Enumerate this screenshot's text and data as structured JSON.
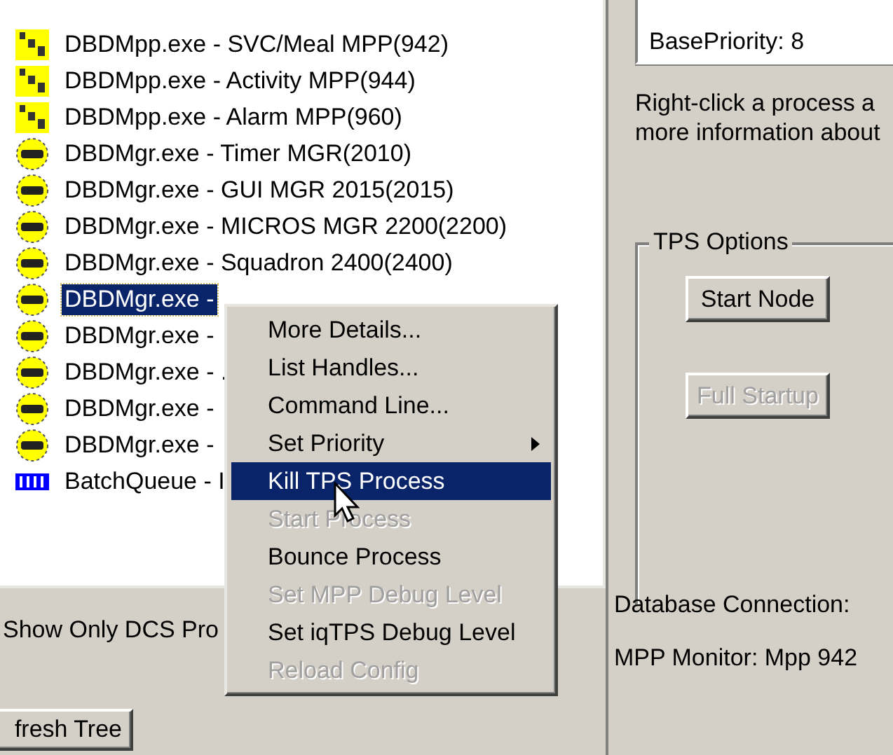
{
  "tree": {
    "items": [
      {
        "kind": "mpp",
        "label": "DBDMpp.exe - SVC/Meal MPP(942)",
        "selected": false
      },
      {
        "kind": "mpp",
        "label": "DBDMpp.exe - Activity MPP(944)",
        "selected": false
      },
      {
        "kind": "mpp",
        "label": "DBDMpp.exe - Alarm MPP(960)",
        "selected": false
      },
      {
        "kind": "mgr",
        "label": "DBDMgr.exe - Timer MGR(2010)",
        "selected": false
      },
      {
        "kind": "mgr",
        "label": "DBDMgr.exe - GUI MGR 2015(2015)",
        "selected": false
      },
      {
        "kind": "mgr",
        "label": "DBDMgr.exe - MICROS MGR 2200(2200)",
        "selected": false
      },
      {
        "kind": "mgr",
        "label": "DBDMgr.exe - Squadron 2400(2400)",
        "selected": false
      },
      {
        "kind": "mgr",
        "label": "DBDMgr.exe -",
        "selected": true
      },
      {
        "kind": "mgr",
        "label": "DBDMgr.exe -",
        "selected": false
      },
      {
        "kind": "mgr",
        "label": "DBDMgr.exe - .",
        "selected": false
      },
      {
        "kind": "mgr",
        "label": "DBDMgr.exe -",
        "selected": false
      },
      {
        "kind": "mgr",
        "label": "DBDMgr.exe -",
        "selected": false
      },
      {
        "kind": "queue",
        "label": "BatchQueue - I",
        "selected": false
      }
    ]
  },
  "filter_label": "Show Only DCS Pro",
  "refresh_button": "fresh Tree",
  "details_box": {
    "text": "BasePriority: 8"
  },
  "hint_lines": [
    "Right-click a process a",
    "more information about"
  ],
  "tps_options": {
    "title": "TPS Options",
    "buttons": [
      {
        "label": "Start Node",
        "disabled": false
      },
      {
        "label": "Full Startup",
        "disabled": true
      }
    ]
  },
  "status": [
    {
      "label": "Database Connection:"
    },
    {
      "label": "MPP Monitor:  Mpp 942"
    }
  ],
  "context_menu": {
    "items": [
      {
        "label": "More Details...",
        "disabled": false,
        "selected": false,
        "submenu": false
      },
      {
        "label": "List Handles...",
        "disabled": false,
        "selected": false,
        "submenu": false
      },
      {
        "label": "Command Line...",
        "disabled": false,
        "selected": false,
        "submenu": false
      },
      {
        "label": "Set Priority",
        "disabled": false,
        "selected": false,
        "submenu": true
      },
      {
        "label": "Kill TPS Process",
        "disabled": false,
        "selected": true,
        "submenu": false
      },
      {
        "label": "Start Process",
        "disabled": true,
        "selected": false,
        "submenu": false
      },
      {
        "label": "Bounce Process",
        "disabled": false,
        "selected": false,
        "submenu": false
      },
      {
        "label": "Set MPP Debug Level",
        "disabled": true,
        "selected": false,
        "submenu": false
      },
      {
        "label": "Set iqTPS Debug Level",
        "disabled": false,
        "selected": false,
        "submenu": false
      },
      {
        "label": "Reload Config",
        "disabled": true,
        "selected": false,
        "submenu": false
      }
    ]
  }
}
